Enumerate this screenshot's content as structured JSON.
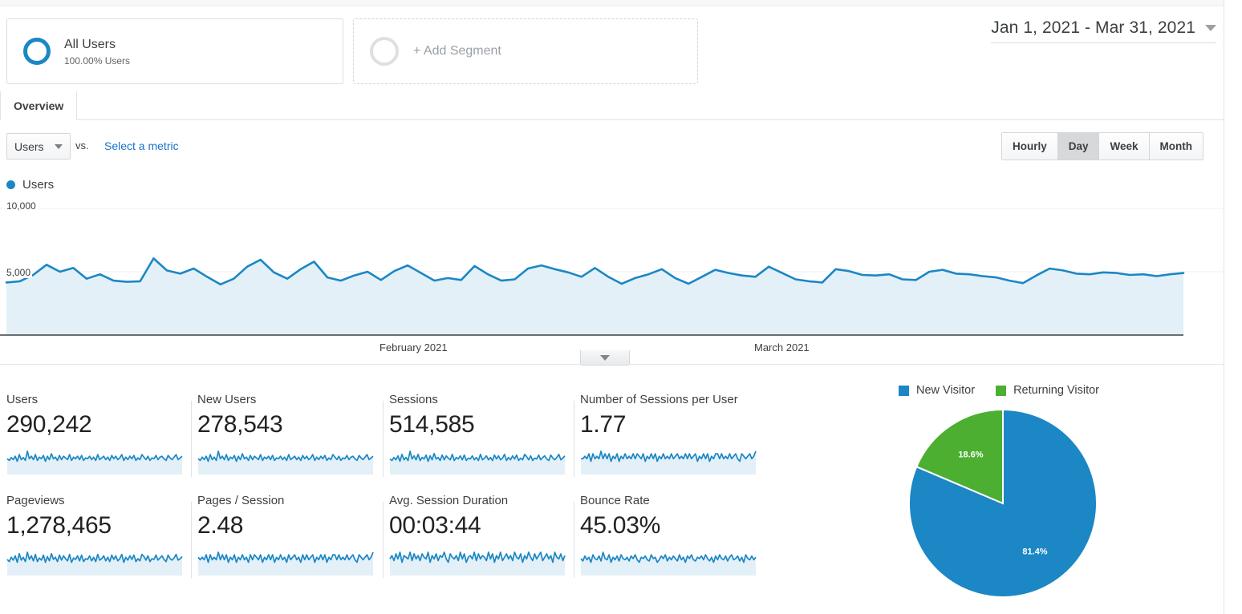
{
  "segments": {
    "all_users": {
      "title": "All Users",
      "subtitle": "100.00% Users",
      "icon": "ring-icon"
    },
    "add_segment": {
      "label": "+ Add Segment",
      "icon": "empty-ring-icon"
    }
  },
  "date_range": {
    "text": "Jan 1, 2021 - Mar 31, 2021",
    "icon": "caret-down-icon"
  },
  "tabs": [
    {
      "label": "Overview",
      "active": true
    }
  ],
  "metric_controls": {
    "selected_metric": "Users",
    "vs_label": "vs.",
    "compare_link": "Select a metric",
    "granularity": [
      {
        "label": "Hourly",
        "active": false
      },
      {
        "label": "Day",
        "active": true
      },
      {
        "label": "Week",
        "active": false
      },
      {
        "label": "Month",
        "active": false
      }
    ]
  },
  "chart_legend": {
    "label": "Users",
    "color": "#1b87c5"
  },
  "collapse_handle": {
    "icon": "caret-down-icon"
  },
  "metric_cards": [
    [
      {
        "title": "Users",
        "value": "290,242"
      },
      {
        "title": "New Users",
        "value": "278,543"
      },
      {
        "title": "Sessions",
        "value": "514,585"
      },
      {
        "title": "Number of Sessions per User",
        "value": "1.77"
      }
    ],
    [
      {
        "title": "Pageviews",
        "value": "1,278,465"
      },
      {
        "title": "Pages / Session",
        "value": "2.48"
      },
      {
        "title": "Avg. Session Duration",
        "value": "00:03:44"
      },
      {
        "title": "Bounce Rate",
        "value": "45.03%"
      }
    ]
  ],
  "chart_data": [
    {
      "type": "area",
      "title": "Users",
      "xlabel": "",
      "ylabel": "Users",
      "ylim": [
        0,
        10000
      ],
      "yticks": [
        5000,
        10000
      ],
      "ytick_labels": [
        "5,000",
        "10,000"
      ],
      "xtick_labels": [
        "February 2021",
        "March 2021"
      ],
      "grid": true,
      "line_color": "#1b87c5",
      "fill_color": "#e4f0f7",
      "series": [
        {
          "name": "Users",
          "values": [
            4150,
            4250,
            4750,
            5550,
            5000,
            5300,
            4450,
            4800,
            4300,
            4200,
            4250,
            6050,
            5100,
            4850,
            5250,
            4600,
            4000,
            4450,
            5400,
            5950,
            4950,
            4450,
            5200,
            5800,
            4550,
            4300,
            4700,
            5000,
            4350,
            5050,
            5500,
            4900,
            4300,
            4500,
            4350,
            5450,
            4800,
            4300,
            4400,
            5250,
            5500,
            5200,
            4950,
            4600,
            5300,
            4600,
            4050,
            4500,
            4800,
            5200,
            4500,
            4050,
            4600,
            5150,
            4900,
            4700,
            4600,
            5400,
            4900,
            4400,
            4250,
            4150,
            5200,
            5050,
            4750,
            4700,
            4800,
            4400,
            4350,
            5000,
            5150,
            4850,
            4800,
            4650,
            4550,
            4300,
            4100,
            4700,
            5250,
            5100,
            4850,
            4800,
            4950,
            4900,
            4750,
            4800,
            4650,
            4800,
            4900
          ]
        }
      ]
    },
    {
      "type": "pie",
      "title": "New vs Returning Visitors",
      "legend_position": "top",
      "labels": [
        "New Visitor",
        "Returning Visitor"
      ],
      "values": [
        81.4,
        18.6
      ],
      "value_labels": [
        "81.4%",
        "18.6%"
      ],
      "colors": [
        "#1b87c5",
        "#4caf32"
      ]
    },
    {
      "type": "line",
      "title": "Users sparkline",
      "values": [
        52,
        48,
        55,
        50,
        58,
        46,
        62,
        50,
        55,
        48,
        70,
        52,
        58,
        50,
        62,
        48,
        56,
        52,
        60,
        46,
        58,
        50,
        64,
        52,
        56,
        48,
        60,
        50,
        58,
        54,
        50,
        62,
        48,
        56,
        52,
        58,
        50,
        60,
        48,
        54,
        52,
        58,
        50,
        56,
        48,
        62,
        50,
        54,
        58,
        50,
        56,
        48,
        60,
        52,
        58,
        50,
        54,
        62,
        48,
        56,
        50,
        58,
        52,
        60,
        48,
        54,
        50,
        62,
        56,
        50,
        58,
        48,
        54,
        52,
        60,
        50,
        56,
        58,
        52,
        48,
        60,
        54,
        50,
        56,
        62,
        50,
        54,
        58
      ]
    },
    {
      "type": "line",
      "title": "New Users sparkline",
      "values": [
        50,
        46,
        54,
        48,
        56,
        44,
        60,
        48,
        54,
        46,
        68,
        50,
        56,
        48,
        60,
        46,
        54,
        50,
        58,
        44,
        56,
        48,
        62,
        50,
        54,
        46,
        58,
        48,
        56,
        52,
        48,
        60,
        46,
        54,
        50,
        56,
        48,
        58,
        46,
        52,
        50,
        56,
        48,
        54,
        46,
        60,
        48,
        52,
        56,
        48,
        54,
        46,
        58,
        50,
        56,
        48,
        52,
        60,
        46,
        54,
        48,
        56,
        50,
        58,
        46,
        52,
        48,
        60,
        54,
        48,
        56,
        46,
        52,
        50,
        58,
        48,
        54,
        56,
        50,
        46,
        58,
        52,
        48,
        54,
        60,
        48,
        52,
        56
      ]
    },
    {
      "type": "line",
      "title": "Sessions sparkline",
      "values": [
        54,
        50,
        58,
        52,
        62,
        48,
        66,
        52,
        58,
        50,
        74,
        54,
        62,
        52,
        66,
        50,
        58,
        54,
        64,
        48,
        62,
        52,
        68,
        54,
        58,
        50,
        64,
        52,
        62,
        56,
        52,
        66,
        50,
        58,
        54,
        62,
        52,
        64,
        50,
        56,
        54,
        62,
        52,
        58,
        50,
        66,
        52,
        56,
        62,
        52,
        58,
        50,
        64,
        54,
        62,
        52,
        56,
        66,
        50,
        58,
        52,
        62,
        54,
        64,
        50,
        56,
        52,
        66,
        60,
        52,
        62,
        50,
        56,
        54,
        64,
        52,
        58,
        62,
        54,
        50,
        64,
        56,
        52,
        58,
        66,
        52,
        56,
        62
      ]
    },
    {
      "type": "line",
      "title": "Number of Sessions per User sparkline",
      "values": [
        50,
        50,
        51,
        50,
        52,
        49,
        52,
        50,
        51,
        50,
        53,
        50,
        52,
        50,
        52,
        49,
        51,
        50,
        52,
        49,
        51,
        50,
        52,
        50,
        51,
        50,
        52,
        50,
        52,
        51,
        50,
        52,
        49,
        51,
        50,
        52,
        50,
        52,
        49,
        51,
        50,
        52,
        50,
        51,
        50,
        52,
        50,
        51,
        52,
        50,
        51,
        50,
        52,
        50,
        52,
        50,
        51,
        52,
        49,
        51,
        50,
        52,
        50,
        52,
        49,
        51,
        50,
        52,
        52,
        50,
        52,
        50,
        51,
        50,
        52,
        50,
        51,
        52,
        50,
        49,
        52,
        51,
        50,
        51,
        52,
        50,
        51,
        53
      ]
    },
    {
      "type": "line",
      "title": "Pageviews sparkline",
      "values": [
        52,
        46,
        58,
        50,
        62,
        44,
        68,
        50,
        58,
        46,
        72,
        52,
        62,
        48,
        66,
        46,
        56,
        50,
        64,
        44,
        60,
        48,
        68,
        52,
        58,
        46,
        64,
        50,
        62,
        54,
        48,
        66,
        44,
        56,
        52,
        62,
        48,
        64,
        46,
        54,
        52,
        62,
        48,
        58,
        46,
        66,
        50,
        54,
        62,
        48,
        58,
        46,
        64,
        52,
        62,
        48,
        54,
        66,
        44,
        58,
        50,
        62,
        52,
        64,
        46,
        54,
        48,
        66,
        60,
        50,
        62,
        46,
        54,
        52,
        64,
        50,
        56,
        62,
        52,
        46,
        64,
        54,
        50,
        56,
        66,
        50,
        54,
        60
      ]
    },
    {
      "type": "line",
      "title": "Pages / Session sparkline",
      "values": [
        52,
        51,
        52,
        51,
        53,
        50,
        53,
        51,
        52,
        51,
        54,
        51,
        53,
        51,
        53,
        50,
        52,
        51,
        53,
        50,
        52,
        51,
        53,
        51,
        52,
        50,
        53,
        51,
        53,
        52,
        51,
        53,
        50,
        52,
        51,
        53,
        51,
        53,
        50,
        52,
        51,
        53,
        51,
        52,
        50,
        53,
        51,
        52,
        53,
        51,
        52,
        50,
        53,
        51,
        53,
        51,
        52,
        53,
        50,
        52,
        51,
        53,
        51,
        53,
        50,
        52,
        51,
        53,
        53,
        51,
        53,
        51,
        52,
        51,
        53,
        51,
        52,
        53,
        51,
        50,
        53,
        52,
        51,
        52,
        53,
        51,
        52,
        54
      ]
    },
    {
      "type": "line",
      "title": "Avg. Session Duration sparkline",
      "values": [
        50,
        54,
        48,
        56,
        50,
        58,
        46,
        54,
        52,
        50,
        58,
        48,
        56,
        50,
        54,
        48,
        56,
        52,
        50,
        58,
        46,
        54,
        50,
        56,
        48,
        54,
        52,
        58,
        50,
        46,
        56,
        52,
        50,
        54,
        48,
        58,
        50,
        56,
        46,
        52,
        54,
        50,
        58,
        48,
        56,
        50,
        54,
        52,
        48,
        58,
        50,
        56,
        46,
        54,
        50,
        58,
        48,
        52,
        56,
        50,
        54,
        48,
        58,
        52,
        50,
        56,
        46,
        54,
        50,
        58,
        52,
        48,
        56,
        50,
        54,
        58,
        48,
        52,
        56,
        50,
        54,
        46,
        58,
        52,
        50,
        56,
        48,
        54
      ]
    },
    {
      "type": "line",
      "title": "Bounce Rate sparkline",
      "values": [
        52,
        48,
        56,
        50,
        54,
        46,
        58,
        52,
        50,
        56,
        48,
        62,
        52,
        50,
        58,
        46,
        54,
        50,
        56,
        48,
        58,
        52,
        50,
        54,
        48,
        56,
        52,
        58,
        50,
        46,
        54,
        52,
        56,
        50,
        48,
        58,
        52,
        54,
        46,
        50,
        56,
        52,
        58,
        48,
        54,
        50,
        56,
        52,
        48,
        58,
        50,
        54,
        46,
        56,
        52,
        58,
        50,
        48,
        54,
        52,
        56,
        50,
        58,
        52,
        48,
        54,
        46,
        56,
        50,
        58,
        52,
        50,
        56,
        48,
        54,
        58,
        50,
        52,
        56,
        48,
        54,
        46,
        58,
        52,
        50,
        56,
        50,
        54
      ]
    }
  ],
  "colors": {
    "accent_blue": "#1b87c5",
    "green": "#4caf32",
    "link_blue": "#1a73c8",
    "fill_light": "#e4f0f7"
  }
}
